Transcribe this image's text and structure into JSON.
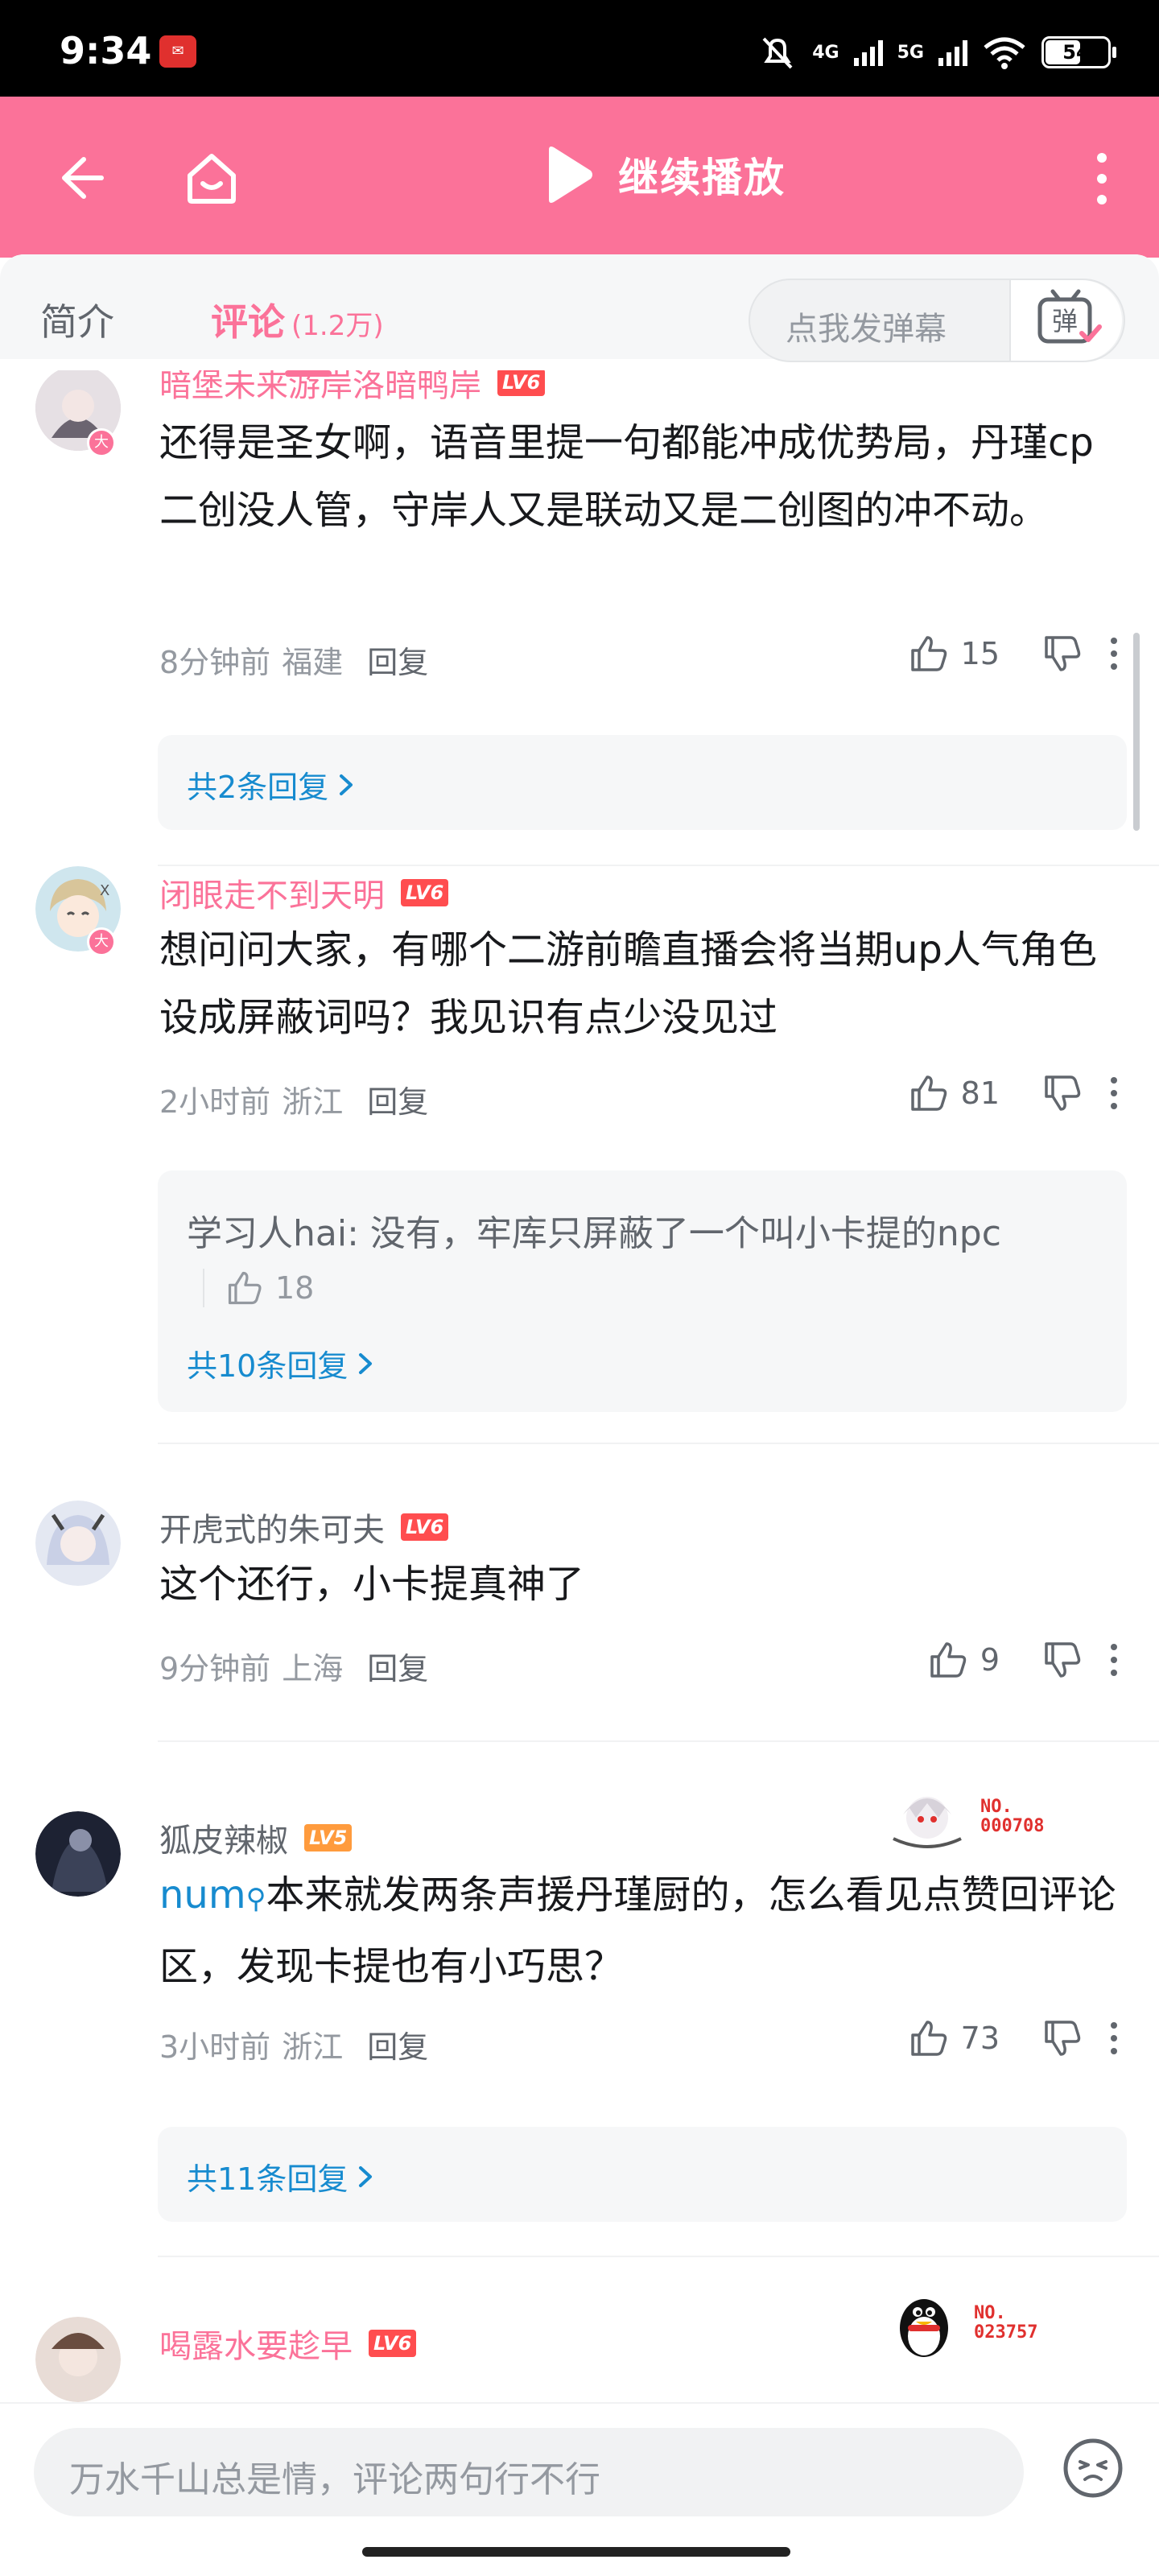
{
  "status_bar": {
    "time": "9:34",
    "network_4g": "4G",
    "network_5g": "5G",
    "battery": "54",
    "battery_level": 0.54
  },
  "header": {
    "title": "继续播放"
  },
  "tabs": {
    "intro": "简介",
    "comments": "评论",
    "comments_count": "(1.2万)"
  },
  "danmaku": {
    "placeholder": "点我发弹幕",
    "icon_label": "弹"
  },
  "comments": [
    {
      "username": "暗堡未来游岸洛暗鸭岸",
      "level": "LV6",
      "avatar_badge": "大",
      "content": "还得是圣女啊，语音里提一句都能冲成优势局，丹瑾cp二创没人管，守岸人又是联动又是二创图的冲不动。",
      "time": "8分钟前",
      "location": "福建",
      "reply_label": "回复",
      "likes": "15",
      "replies_link": "共2条回复"
    },
    {
      "username": "闭眼走不到天明",
      "level": "LV6",
      "avatar_badge": "大",
      "content": "想问问大家，有哪个二游前瞻直播会将当期up人气角色设成屏蔽词吗？我见识有点少没见过",
      "time": "2小时前",
      "location": "浙江",
      "reply_label": "回复",
      "likes": "81",
      "sub_reply": "学习人hai: 没有，牢库只屏蔽了一个叫小卡提的npc",
      "sub_reply_likes": "18",
      "replies_link": "共10条回复"
    },
    {
      "username": "开虎式的朱可夫",
      "level": "LV6",
      "content": "这个还行，小卡提真神了",
      "time": "9分钟前",
      "location": "上海",
      "reply_label": "回复",
      "likes": "9"
    },
    {
      "username": "狐皮辣椒",
      "level": "LV5",
      "decoration_no": "NO.\n000708",
      "mention": "num",
      "content": "本来就发两条声援丹瑾厨的，怎么看见点赞回评论区，发现卡提也有小巧思？",
      "time": "3小时前",
      "location": "浙江",
      "reply_label": "回复",
      "likes": "73",
      "replies_link": "共11条回复"
    },
    {
      "username": "喝露水要趁早",
      "level": "LV6",
      "decoration_no": "NO.\n023757"
    }
  ],
  "bottom_bar": {
    "placeholder": "万水千山总是情，评论两句行不行"
  }
}
